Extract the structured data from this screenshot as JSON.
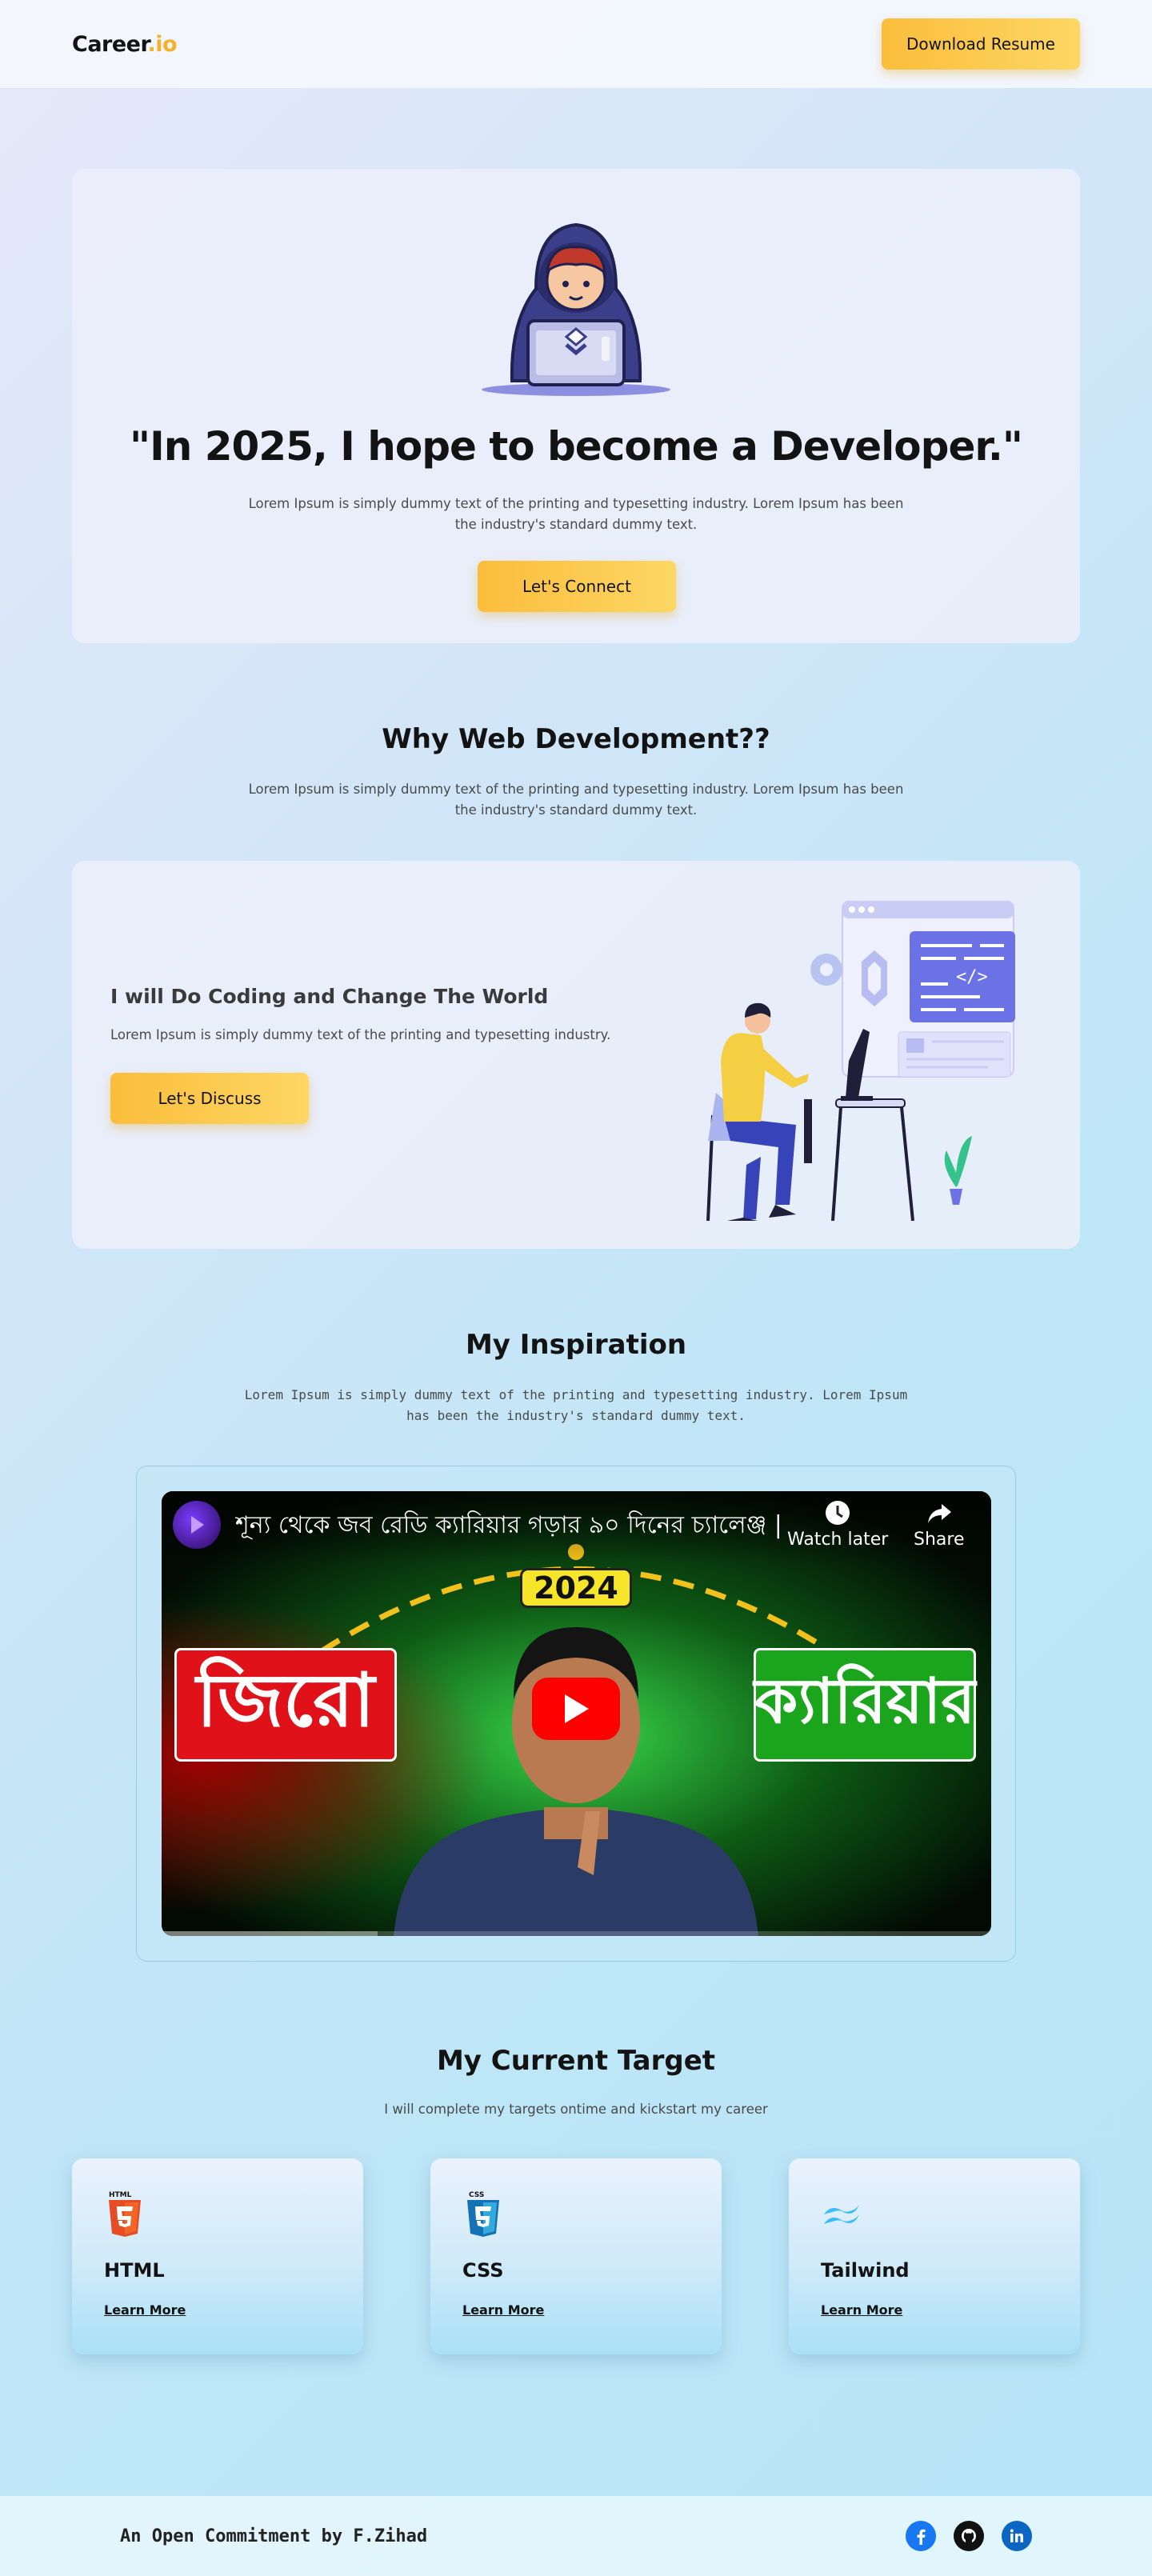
{
  "nav": {
    "logo_main": "Career",
    "logo_accent": ".io",
    "cta_label": "Download Resume"
  },
  "hero": {
    "title": "\"In 2025, I hope to become a Developer.\"",
    "description": "Lorem Ipsum is simply dummy text of the printing and typesetting industry. Lorem Ipsum has been the industry's standard dummy text.",
    "button_label": "Let's Connect"
  },
  "why": {
    "title": "Why Web Development??",
    "description": "Lorem Ipsum is simply dummy text of the printing and typesetting industry. Lorem Ipsum has been the industry's standard dummy text.",
    "card_heading": "I will Do Coding and Change The World",
    "card_text": "Lorem Ipsum is simply dummy text of the printing and typesetting industry.",
    "button_label": "Let's Discuss"
  },
  "inspiration": {
    "title": "My Inspiration",
    "description": "Lorem Ipsum is simply dummy text of the printing and typesetting industry. Lorem Ipsum has been the industry's standard dummy text.",
    "video": {
      "title": "শূন্য থেকে জব রেডি ক্যারিয়ার গড়ার ৯০ দিনের চ্যালেঞ্জ | ...",
      "watch_later": "Watch later",
      "share": "Share",
      "year_badge": "2024",
      "left_word": "জিরো",
      "right_word": "ক্যারিয়ার",
      "progress": 0.26
    }
  },
  "target": {
    "title": "My Current Target",
    "description": "I will complete my targets ontime and kickstart my career",
    "cards": [
      {
        "name": "HTML",
        "link": "Learn More",
        "icon": "html5-icon"
      },
      {
        "name": "CSS",
        "link": "Learn More",
        "icon": "css3-icon"
      },
      {
        "name": "Tailwind",
        "link": "Learn More",
        "icon": "tailwind-icon"
      }
    ]
  },
  "footer": {
    "text": "An Open Commitment by F.Zihad",
    "socials": [
      "facebook-icon",
      "github-icon",
      "linkedin-icon"
    ]
  },
  "colors": {
    "accent": "#fbbd3b",
    "facebook": "#1877f2",
    "linkedin": "#0a66c2",
    "youtube": "#ff0000"
  }
}
